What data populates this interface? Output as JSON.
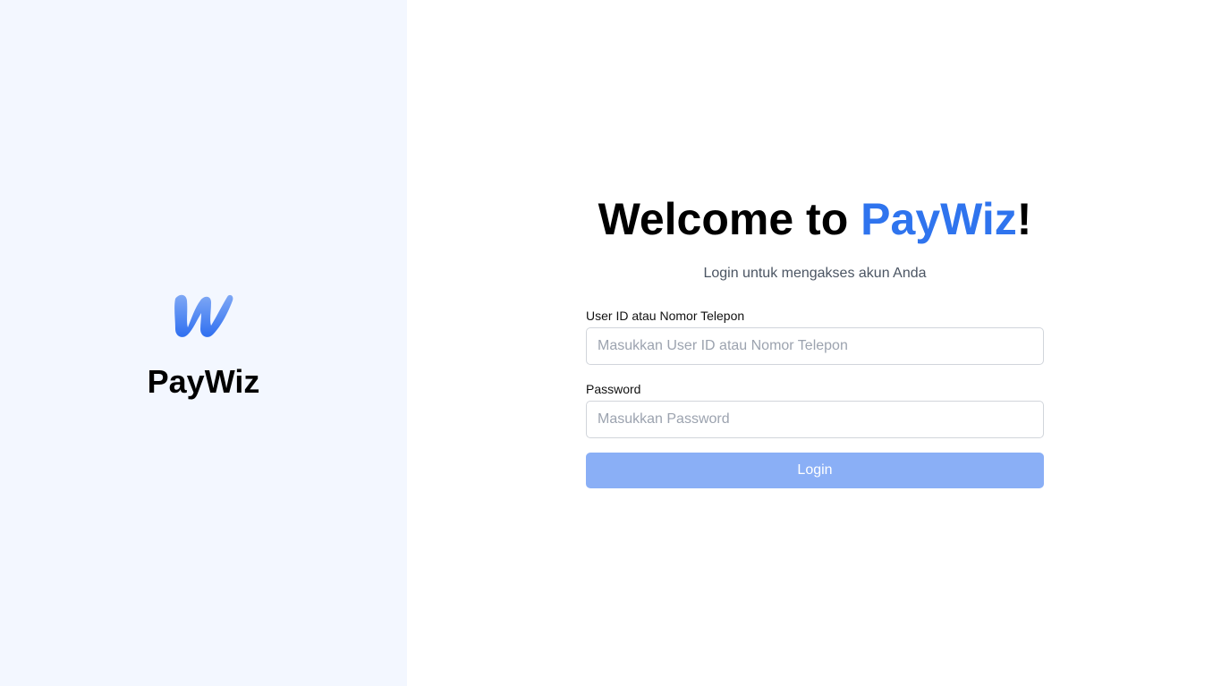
{
  "brand": {
    "name": "PayWiz",
    "logo_icon": "paywiz-w-logo",
    "accent_color": "#2f74ee"
  },
  "welcome": {
    "prefix": "Welcome to ",
    "brand": "PayWiz",
    "suffix": "!"
  },
  "subtitle": "Login untuk mengakses akun Anda",
  "form": {
    "user_label": "User ID atau Nomor Telepon",
    "user_placeholder": "Masukkan User ID atau Nomor Telepon",
    "user_value": "",
    "password_label": "Password",
    "password_placeholder": "Masukkan Password",
    "password_value": "",
    "login_label": "Login",
    "login_button_color": "#8aaff6"
  }
}
